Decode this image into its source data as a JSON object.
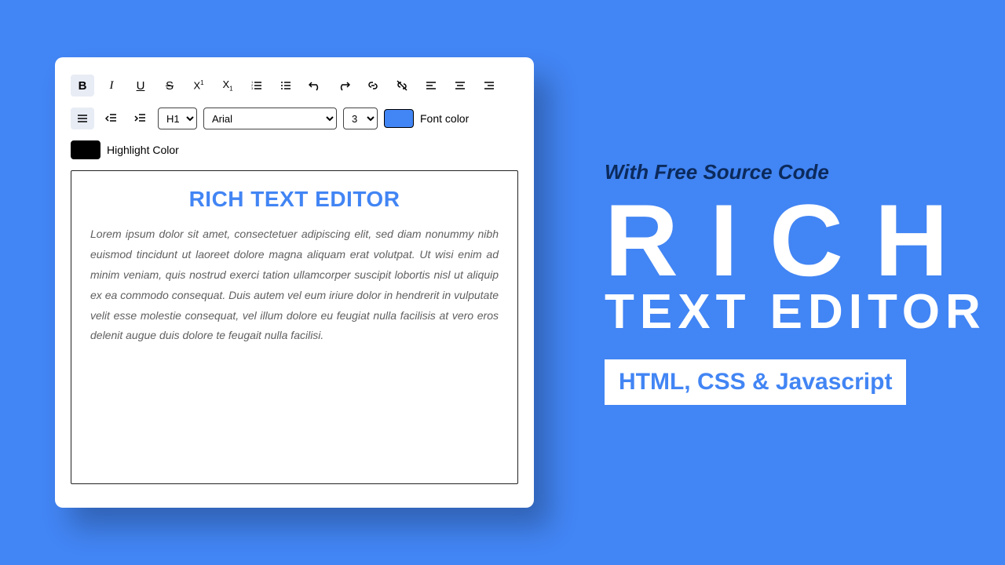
{
  "editor": {
    "toolbar": {
      "heading_value": "H1",
      "font_value": "Arial",
      "size_value": "3",
      "font_color_label": "Font color",
      "font_color_value": "#4285f4",
      "highlight_color_label": "Highlight Color",
      "highlight_color_value": "#000000"
    },
    "content": {
      "title": "RICH TEXT EDITOR",
      "body": "Lorem ipsum dolor sit amet, consectetuer adipiscing elit, sed diam nonummy nibh euismod tincidunt ut laoreet dolore magna aliquam erat volutpat. Ut wisi enim ad minim veniam, quis nostrud exerci tation ullamcorper suscipit lobortis nisl ut aliquip ex ea commodo consequat. Duis autem vel eum iriure dolor in hendrerit in vulputate velit esse molestie consequat, vel illum dolore eu feugiat nulla facilisis at vero eros delenit augue duis dolore te feugait nulla facilisi."
    }
  },
  "promo": {
    "subtitle": "With Free Source Code",
    "line1": "RICH",
    "line2": "TEXT EDITOR",
    "tag": "HTML, CSS & Javascript"
  }
}
